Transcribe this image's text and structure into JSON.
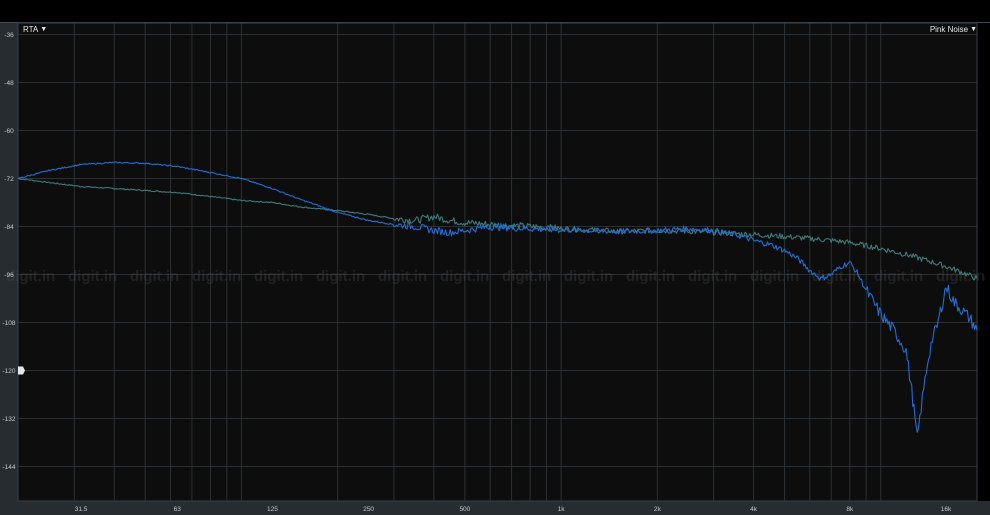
{
  "analyzer": {
    "mode_menu": {
      "label": "RTA",
      "arrow": "▼"
    },
    "source_menu": {
      "label": "Pink Noise",
      "arrow": "▼"
    },
    "watermark": "digit.in"
  },
  "colors": {
    "background": "#0d0d0d",
    "grid": "#2c3033",
    "axis_strip": "#272c30",
    "tick_text": "#c8ccd0",
    "reference_curve": "#3e7a7a",
    "measured_curve": "#1e6fd6",
    "marker": "#e6e6e6"
  },
  "chart_data": {
    "type": "line",
    "title": "",
    "xlabel": "",
    "ylabel": "",
    "xscale": "log",
    "xlim": [
      20,
      20000
    ],
    "ylim": [
      -150,
      -36
    ],
    "grid": true,
    "x_tick_labels": [
      {
        "value": 31.5,
        "label": "31.5"
      },
      {
        "value": 63,
        "label": "63"
      },
      {
        "value": 125,
        "label": "125"
      },
      {
        "value": 250,
        "label": "250"
      },
      {
        "value": 500,
        "label": "500"
      },
      {
        "value": 1000,
        "label": "1k"
      },
      {
        "value": 2000,
        "label": "2k"
      },
      {
        "value": 4000,
        "label": "4k"
      },
      {
        "value": 8000,
        "label": "8k"
      },
      {
        "value": 16000,
        "label": "16k"
      }
    ],
    "y_tick_labels": [
      {
        "value": -36,
        "label": "-36"
      },
      {
        "value": -48,
        "label": "-48"
      },
      {
        "value": -60,
        "label": "-60"
      },
      {
        "value": -72,
        "label": "-72"
      },
      {
        "value": -84,
        "label": "-84"
      },
      {
        "value": -96,
        "label": "-96"
      },
      {
        "value": -108,
        "label": "-108"
      },
      {
        "value": -120,
        "label": "-120"
      },
      {
        "value": -132,
        "label": "-132"
      },
      {
        "value": -144,
        "label": "-144"
      }
    ],
    "marker_level": -120,
    "series": [
      {
        "values": [
          [
            20,
            -72
          ],
          [
            25,
            -73
          ],
          [
            31.5,
            -74
          ],
          [
            40,
            -74.5
          ],
          [
            50,
            -75
          ],
          [
            63,
            -75.5
          ],
          [
            80,
            -76.5
          ],
          [
            100,
            -77.5
          ],
          [
            125,
            -78
          ],
          [
            150,
            -79
          ],
          [
            170,
            -79.5
          ],
          [
            200,
            -80
          ],
          [
            250,
            -81
          ],
          [
            300,
            -82
          ],
          [
            350,
            -82.5
          ],
          [
            400,
            -81.5
          ],
          [
            450,
            -82.5
          ],
          [
            500,
            -83
          ],
          [
            600,
            -83.5
          ],
          [
            700,
            -83.8
          ],
          [
            800,
            -84
          ],
          [
            1000,
            -84.5
          ],
          [
            1200,
            -84.8
          ],
          [
            1500,
            -85.2
          ],
          [
            2000,
            -85
          ],
          [
            2500,
            -85.2
          ],
          [
            3000,
            -85.5
          ],
          [
            4000,
            -86
          ],
          [
            5000,
            -86.5
          ],
          [
            6000,
            -87
          ],
          [
            7000,
            -87.5
          ],
          [
            8000,
            -88
          ],
          [
            10000,
            -89.5
          ],
          [
            12000,
            -91
          ],
          [
            14000,
            -92.5
          ],
          [
            16000,
            -94
          ],
          [
            18000,
            -95.5
          ],
          [
            20000,
            -97
          ]
        ]
      },
      {
        "values": [
          [
            20,
            -72
          ],
          [
            25,
            -70
          ],
          [
            31.5,
            -68.5
          ],
          [
            40,
            -68
          ],
          [
            50,
            -68.2
          ],
          [
            63,
            -69
          ],
          [
            80,
            -70.5
          ],
          [
            100,
            -72
          ],
          [
            125,
            -74.5
          ],
          [
            150,
            -77
          ],
          [
            170,
            -78.5
          ],
          [
            200,
            -80.5
          ],
          [
            250,
            -82.5
          ],
          [
            300,
            -83.5
          ],
          [
            350,
            -84
          ],
          [
            400,
            -85
          ],
          [
            450,
            -85.5
          ],
          [
            500,
            -85
          ],
          [
            600,
            -84
          ],
          [
            700,
            -84.3
          ],
          [
            800,
            -84.5
          ],
          [
            1000,
            -84.8
          ],
          [
            1200,
            -85
          ],
          [
            1500,
            -85.3
          ],
          [
            2000,
            -85
          ],
          [
            2500,
            -84.5
          ],
          [
            3000,
            -85
          ],
          [
            3500,
            -86
          ],
          [
            4000,
            -87.5
          ],
          [
            4500,
            -88.5
          ],
          [
            5000,
            -90
          ],
          [
            5500,
            -92
          ],
          [
            6000,
            -95
          ],
          [
            6500,
            -97
          ],
          [
            7000,
            -96
          ],
          [
            7500,
            -94
          ],
          [
            8000,
            -93
          ],
          [
            8500,
            -96
          ],
          [
            9000,
            -100
          ],
          [
            10000,
            -106
          ],
          [
            11000,
            -110
          ],
          [
            12000,
            -115
          ],
          [
            12500,
            -125
          ],
          [
            13000,
            -137
          ],
          [
            13500,
            -127
          ],
          [
            14000,
            -118
          ],
          [
            14500,
            -112
          ],
          [
            15000,
            -109
          ],
          [
            15500,
            -104
          ],
          [
            16000,
            -99
          ],
          [
            17000,
            -103
          ],
          [
            18000,
            -105
          ],
          [
            19000,
            -107
          ],
          [
            20000,
            -110
          ]
        ]
      }
    ]
  }
}
